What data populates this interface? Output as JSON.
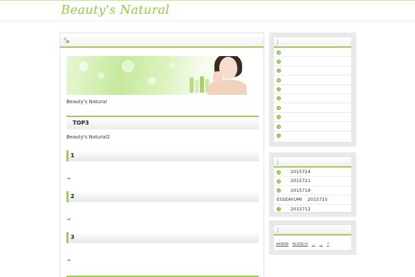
{
  "site": {
    "title": "Beauty's Natural"
  },
  "main": {
    "intro": "Beauty's Natural",
    "top3_heading": "TOP3",
    "top3_text": "Beauty's Natural2",
    "ranks": [
      {
        "label": "1",
        "arrow": "→"
      },
      {
        "label": "2",
        "arrow": "→"
      },
      {
        "label": "3",
        "arrow": "→"
      }
    ]
  },
  "sidebar": {
    "category_count": 10,
    "recent_posts": [
      {
        "prefix": "",
        "date": "2015724"
      },
      {
        "prefix": "",
        "date": "2015721"
      },
      {
        "prefix": "",
        "date": "2015718"
      },
      {
        "prefix": "ESSEAYUMI",
        "date": "2015715"
      },
      {
        "prefix": "",
        "date": "2015712"
      }
    ],
    "tags": [
      "AKB48",
      "BLEACH",
      "...",
      "...",
      "?"
    ]
  },
  "colors": {
    "accent": "#9ccc55",
    "widget_bg": "#e9e9e9"
  }
}
